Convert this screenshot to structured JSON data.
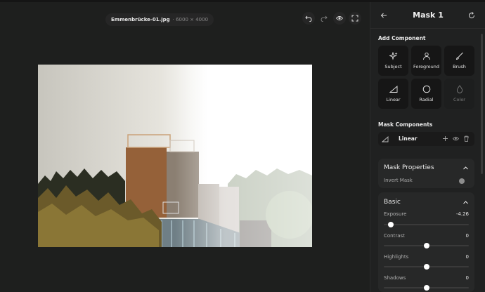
{
  "file": {
    "name": "Emmenbrücke-01.jpg",
    "dims": "· 6000 × 4000"
  },
  "panel": {
    "title": "Mask 1",
    "add_component_title": "Add Component",
    "components": [
      {
        "label": "Subject",
        "icon": "sparkle-icon",
        "enabled": true
      },
      {
        "label": "Foreground",
        "icon": "person-icon",
        "enabled": true
      },
      {
        "label": "Brush",
        "icon": "brush-icon",
        "enabled": true
      },
      {
        "label": "Linear",
        "icon": "linear-gradient-icon",
        "enabled": true
      },
      {
        "label": "Radial",
        "icon": "circle-icon",
        "enabled": true
      },
      {
        "label": "Color",
        "icon": "droplet-icon",
        "enabled": false
      }
    ],
    "mask_components_title": "Mask Components",
    "mask_component_row": {
      "label": "Linear"
    },
    "mask_properties": {
      "title": "Mask Properties",
      "invert_label": "Invert Mask",
      "invert": false
    },
    "basic": {
      "title": "Basic",
      "sliders": [
        {
          "label": "Exposure",
          "value": "-4.26",
          "fraction": 0.08
        },
        {
          "label": "Contrast",
          "value": "0",
          "fraction": 0.5
        },
        {
          "label": "Highlights",
          "value": "0",
          "fraction": 0.5
        },
        {
          "label": "Shadows",
          "value": "0",
          "fraction": 0.5
        }
      ]
    }
  },
  "colors": {
    "accent": "#ffffff",
    "panel": "#202121",
    "card": "#272828",
    "tile": "#161616"
  }
}
